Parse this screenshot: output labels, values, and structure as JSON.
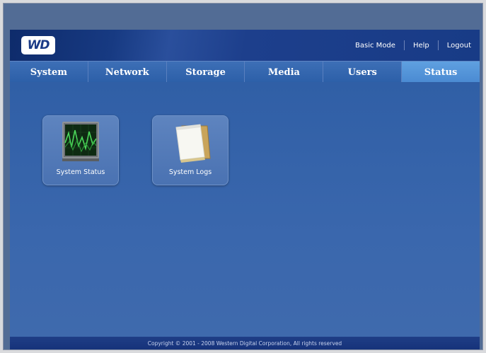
{
  "header": {
    "logo_text": "WD",
    "links": [
      "Basic Mode",
      "Help",
      "Logout"
    ]
  },
  "nav": {
    "tabs": [
      "System",
      "Network",
      "Storage",
      "Media",
      "Users",
      "Status"
    ],
    "active": "Status"
  },
  "tiles": [
    {
      "label": "System Status",
      "icon": "monitor-waveform-icon"
    },
    {
      "label": "System Logs",
      "icon": "notepad-icon"
    }
  ],
  "footer": {
    "copyright": "Copyright © 2001 - 2008 Western Digital Corporation, All rights reserved"
  },
  "colors": {
    "header_dark": "#0e2b6b",
    "nav_bg": "#2c5fa8",
    "nav_active": "#4a8ad2",
    "content_bg": "#3a67ad"
  }
}
